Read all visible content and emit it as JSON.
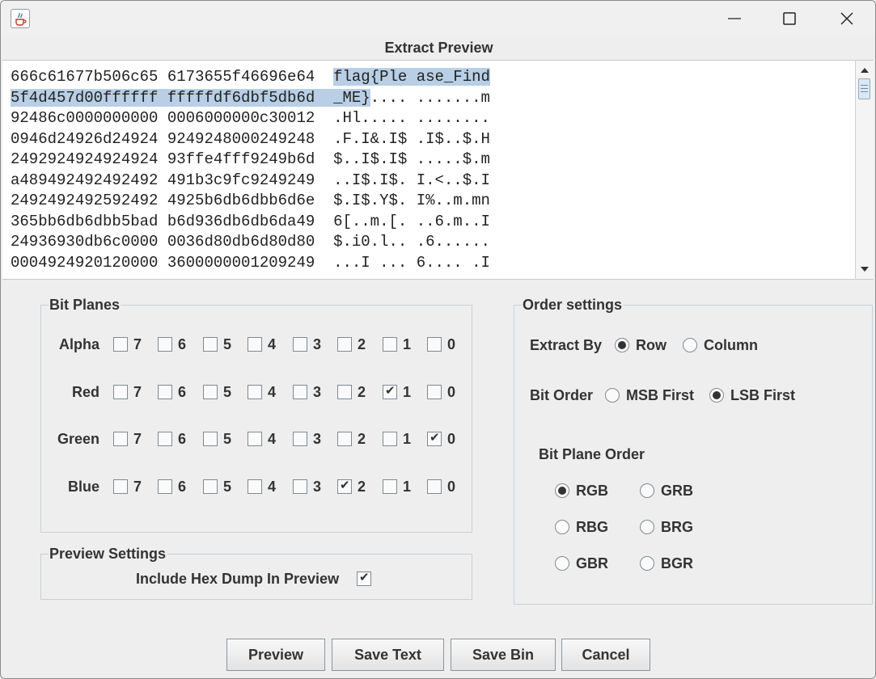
{
  "window": {
    "title": "Extract Preview",
    "app_icon": "java-icon",
    "controls": [
      "minimize-icon",
      "maximize-icon",
      "close-icon"
    ]
  },
  "preview": {
    "lines": [
      {
        "hex": "666c61677b506c65 6173655f46696e64  ",
        "ascii_sel": "flag{Ple ase_Find",
        "ascii_rest": ""
      },
      {
        "hex_sel": "5f4d457d00ffffff fffffdf6dbf5db6d  ",
        "ascii_sel": "_ME}",
        "ascii_rest": ".... .......m"
      },
      {
        "hex": "92486c0000000000 0006000000c30012  ",
        "ascii_rest": ".Hl..... ........"
      },
      {
        "hex": "0946d24926d24924 9249248000249248  ",
        "ascii_rest": ".F.I&.I$ .I$..$.H"
      },
      {
        "hex": "2492924924924924 93ffe4fff9249b6d  ",
        "ascii_rest": "$..I$.I$ .....$.m"
      },
      {
        "hex": "a489492492492492 491b3c9fc9249249  ",
        "ascii_rest": "..I$.I$. I.<..$.I"
      },
      {
        "hex": "2492492492592492 4925b6db6dbb6d6e  ",
        "ascii_rest": "$.I$.Y$. I%..m.mn"
      },
      {
        "hex": "365bb6db6dbb5bad b6d936db6db6da49  ",
        "ascii_rest": "6[..m.[. ..6.m..I"
      },
      {
        "hex": "24936930db6c0000 0036d80db6d80d80  ",
        "ascii_rest": "$.i0.l.. .6......"
      },
      {
        "hex": "0004924920120000 3600000001209249  ",
        "ascii_rest": "...I ... 6.... .I"
      }
    ]
  },
  "bit_planes": {
    "title": "Bit Planes",
    "bits": [
      "7",
      "6",
      "5",
      "4",
      "3",
      "2",
      "1",
      "0"
    ],
    "channels": [
      {
        "label": "Alpha",
        "checked": []
      },
      {
        "label": "Red",
        "checked": [
          "1"
        ]
      },
      {
        "label": "Green",
        "checked": [
          "0"
        ]
      },
      {
        "label": "Blue",
        "checked": [
          "2"
        ]
      }
    ]
  },
  "preview_settings": {
    "title": "Preview Settings",
    "hex_dump_label": "Include Hex Dump In Preview",
    "hex_dump_checked": true
  },
  "order_settings": {
    "title": "Order settings",
    "extract_by": {
      "label": "Extract By",
      "options": [
        "Row",
        "Column"
      ],
      "selected": "Row"
    },
    "bit_order": {
      "label": "Bit Order",
      "options": [
        "MSB First",
        "LSB First"
      ],
      "selected": "LSB First"
    },
    "bit_plane_order": {
      "label": "Bit Plane Order",
      "options": [
        "RGB",
        "GRB",
        "RBG",
        "BRG",
        "GBR",
        "BGR"
      ],
      "selected": "RGB"
    }
  },
  "buttons": {
    "preview": "Preview",
    "save_text": "Save Text",
    "save_bin": "Save Bin",
    "cancel": "Cancel"
  }
}
